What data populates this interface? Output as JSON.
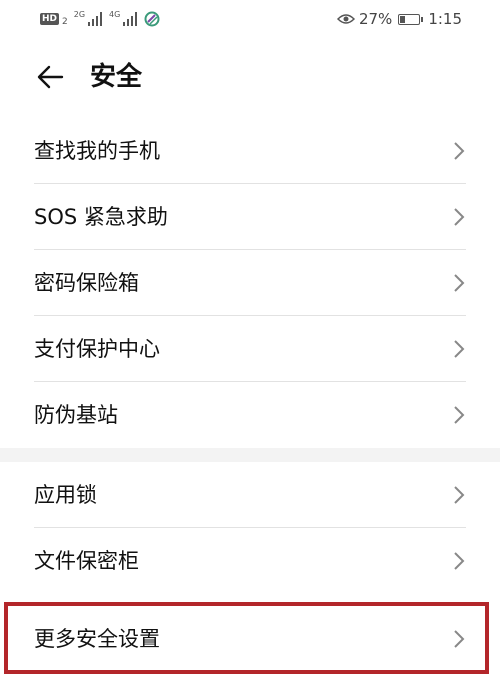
{
  "status_bar": {
    "hd": "HD",
    "sim_index": "2",
    "net_1": "2G",
    "net_2": "4G",
    "battery_percent": "27%",
    "battery_level": 0.27,
    "time": "1:15"
  },
  "header": {
    "title": "安全"
  },
  "group1": {
    "items": [
      {
        "label": "查找我的手机"
      },
      {
        "label": "SOS 紧急求助"
      },
      {
        "label": "密码保险箱"
      },
      {
        "label": "支付保护中心"
      },
      {
        "label": "防伪基站"
      }
    ]
  },
  "group2": {
    "items": [
      {
        "label": "应用锁"
      },
      {
        "label": "文件保密柜"
      },
      {
        "label": "更多安全设置"
      }
    ]
  },
  "colors": {
    "highlight": "#b3262a",
    "background": "#f3f3f3"
  }
}
